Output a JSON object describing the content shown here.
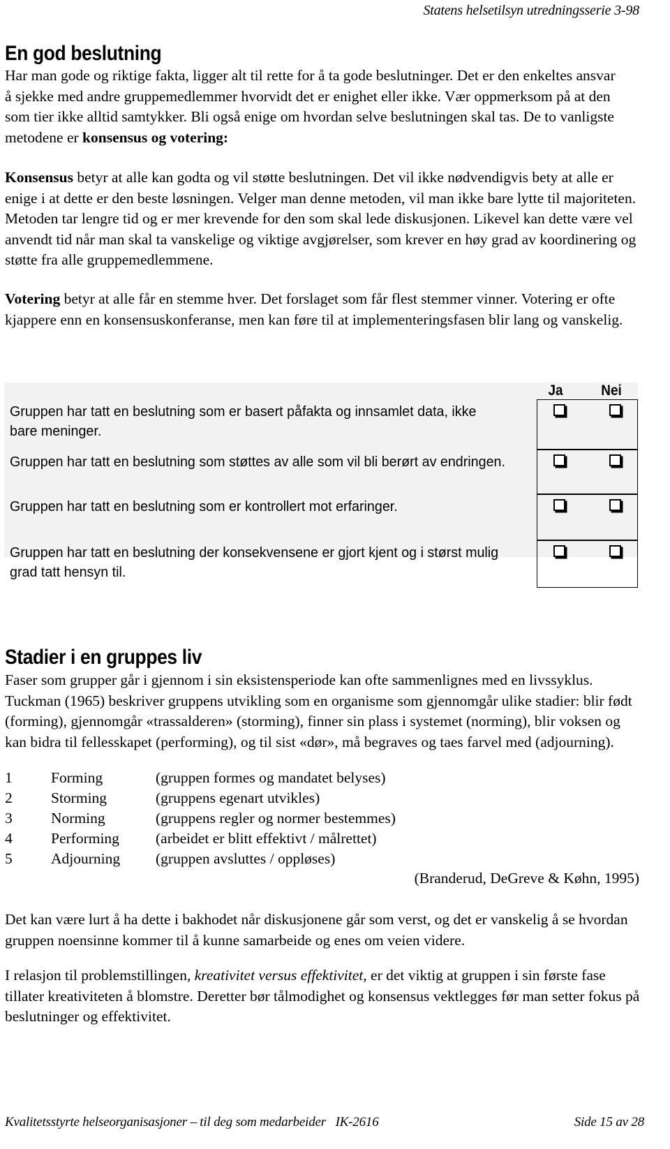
{
  "running_head": "Statens helsetilsyn utredningsserie 3-98",
  "sections": {
    "decision": {
      "heading": "En god beslutning",
      "intro_parts": [
        {
          "text": "Har man gode og riktige fakta, ligger alt til rette for å ta gode beslutninger.  Det er den enkeltes ansvar å sjekke med andre gruppemedlemmer hvorvidt det er enighet eller ikke.  Vær oppmerksom på at den som tier ikke alltid samtykker.  Bli også enige om hvordan selve beslutningen skal tas.  De to vanligste metodene er ",
          "style": "normal"
        },
        {
          "text": "konsensus og votering:",
          "style": "bold"
        }
      ],
      "consensus_parts": [
        {
          "text": "Konsensus",
          "style": "bold"
        },
        {
          "text": " betyr at alle kan godta og vil støtte beslutningen.  Det vil ikke nødvendigvis bety at alle er enige i at dette er den beste løsningen.  Velger man denne metoden, vil man ikke bare lytte til majoriteten.  Metoden tar lengre tid og er mer krevende for den som skal lede diskusjonen.  Likevel kan dette være vel anvendt tid når man skal ta vanskelige og viktige avgjørelser, som krever en høy grad av koordinering og støtte fra alle gruppemedlemmene.",
          "style": "normal"
        }
      ],
      "voting_parts": [
        {
          "text": "Votering",
          "style": "bold"
        },
        {
          "text": " betyr at alle får en stemme hver.  Det forslaget som får flest stemmer vinner. Votering er ofte kjappere enn en konsensuskonferanse, men kan føre til at implementeringsfasen blir lang og vanskelig.",
          "style": "normal"
        }
      ]
    },
    "checklist": {
      "columns": [
        "Ja",
        "Nei"
      ],
      "rows": [
        {
          "label": "Gruppen har tatt en beslutning som er basert påfakta og innsamlet data, ikke bare meninger.",
          "ja": false,
          "nei": false
        },
        {
          "label": "Gruppen har tatt en beslutning som støttes av alle som vil bli berørt av endringen.",
          "ja": false,
          "nei": false
        },
        {
          "label": "Gruppen har tatt en beslutning som er kontrollert mot erfaringer.",
          "ja": false,
          "nei": false
        },
        {
          "label": "Gruppen har tatt en beslutning der konsekvensene er gjort kjent og i størst mulig grad tatt hensyn til.",
          "ja": false,
          "nei": false
        }
      ]
    },
    "stages": {
      "heading": "Stadier i en gruppes liv",
      "intro": "Faser som grupper går i gjennom i sin eksistensperiode kan ofte sammenlignes med en livssyklus. Tuckman (1965) beskriver gruppens utvikling som en organisme som gjennomgår ulike stadier: blir født (forming), gjennomgår «trassalderen» (storming), finner sin plass i systemet (norming), blir voksen og kan bidra til fellesskapet (performing), og til sist «dør», må begraves og taes farvel med (adjourning).",
      "list": [
        {
          "num": "1",
          "name": "Forming",
          "desc": "(gruppen formes og mandatet belyses)"
        },
        {
          "num": "2",
          "name": "Storming",
          "desc": "(gruppens egenart utvikles)"
        },
        {
          "num": "3",
          "name": "Norming",
          "desc": "(gruppens regler og normer bestemmes)"
        },
        {
          "num": "4",
          "name": "Performing",
          "desc": "(arbeidet er blitt effektivt / målrettet)"
        },
        {
          "num": "5",
          "name": "Adjourning",
          "desc": "(gruppen avsluttes / oppløses)"
        }
      ],
      "citation": "(Branderud, DeGreve & Køhn, 1995)",
      "closing_paragraph": "Det kan være lurt å ha dette i bakhodet når diskusjonene går som verst, og det er vanskelig å se hvordan gruppen noensinne kommer til å kunne samarbeide og enes om veien videre.",
      "final_parts": [
        {
          "text": "I relasjon til problemstillingen, ",
          "style": "normal"
        },
        {
          "text": "kreativitet versus effektivitet",
          "style": "italic"
        },
        {
          "text": ", er det viktig at gruppen i sin første fase tillater kreativiteten å blomstre. Deretter bør tålmodighet og konsensus vektlegges før man setter fokus på beslutninger og effektivitet.",
          "style": "normal"
        }
      ]
    }
  },
  "footer": {
    "left": "Kvalitetsstyrte helseorganisasjoner – til deg som medarbeider   IK-2616",
    "right": "Side 15 av 28"
  },
  "colors": {
    "page_background": "#ffffff",
    "text": "#000000",
    "checklist_background": "#f2f2f2",
    "rule": "#000000"
  }
}
